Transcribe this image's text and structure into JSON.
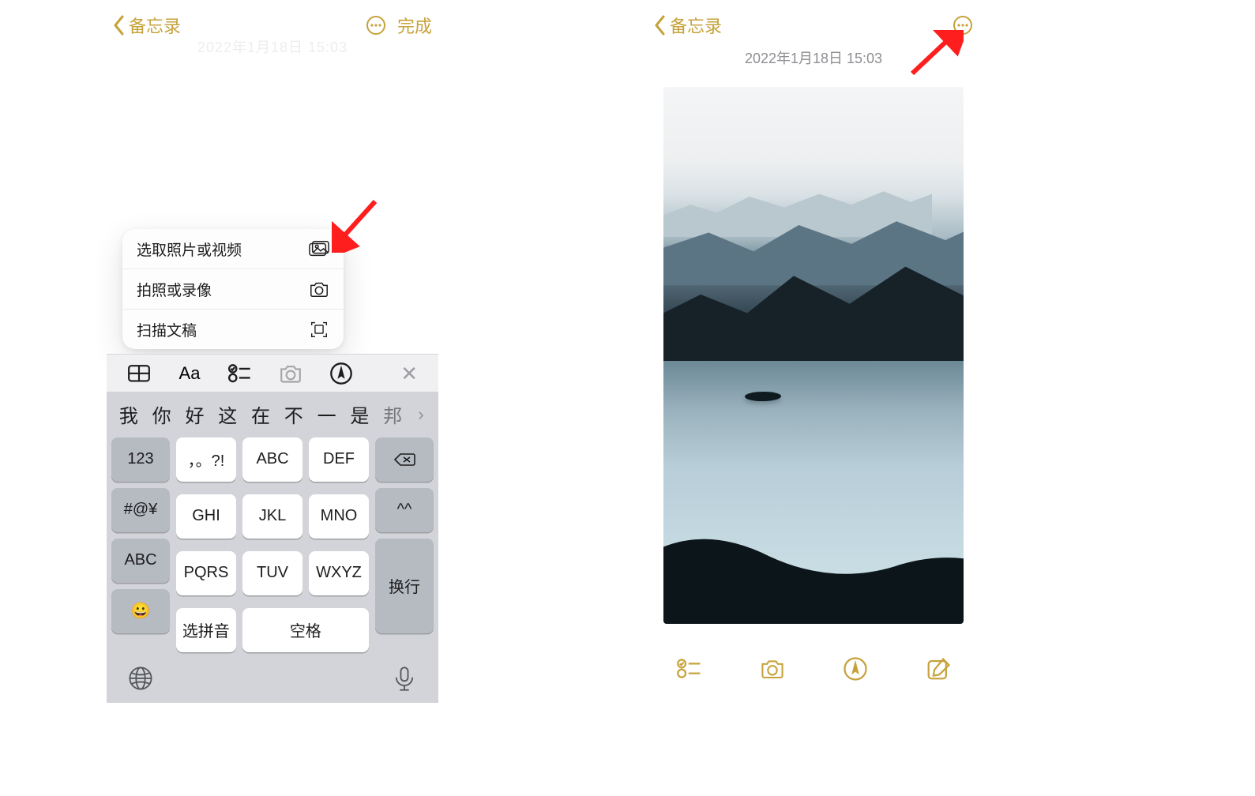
{
  "colors": {
    "accent": "#c6a23a",
    "arrow": "#ff1e1e"
  },
  "left": {
    "back_label": "备忘录",
    "done_label": "完成",
    "timestamp_faded": "2022年1月18日 15:03",
    "popup": {
      "items": [
        {
          "label": "选取照片或视频",
          "icon": "photo-stack-icon"
        },
        {
          "label": "拍照或录像",
          "icon": "camera-icon"
        },
        {
          "label": "扫描文稿",
          "icon": "doc-scan-icon"
        }
      ]
    },
    "fmtbar_icons": [
      "table-icon",
      "text-format-icon",
      "checklist-icon",
      "camera-icon",
      "markup-icon",
      "close-icon"
    ],
    "keyboard": {
      "suggestions": [
        "我",
        "你",
        "好",
        "这",
        "在",
        "不",
        "一",
        "是",
        "邦"
      ],
      "left_col": [
        "123",
        "#@¥",
        "ABC"
      ],
      "grid": [
        [
          "，。?!",
          "ABC",
          "DEF"
        ],
        [
          "GHI",
          "JKL",
          "MNO"
        ],
        [
          "PQRS",
          "TUV",
          "WXYZ"
        ]
      ],
      "right_col_top": "⌫",
      "right_col_mid": "^^",
      "right_col_bottom": "换行",
      "emoji_key": "😀",
      "pinyin_key": "选拼音",
      "space_key": "空格",
      "bottom_icons": [
        "globe-icon",
        "mic-icon"
      ]
    }
  },
  "right": {
    "back_label": "备忘录",
    "timestamp": "2022年1月18日 15:03",
    "toolbar_icons": [
      "checklist-icon",
      "camera-icon",
      "markup-icon",
      "compose-icon"
    ]
  }
}
